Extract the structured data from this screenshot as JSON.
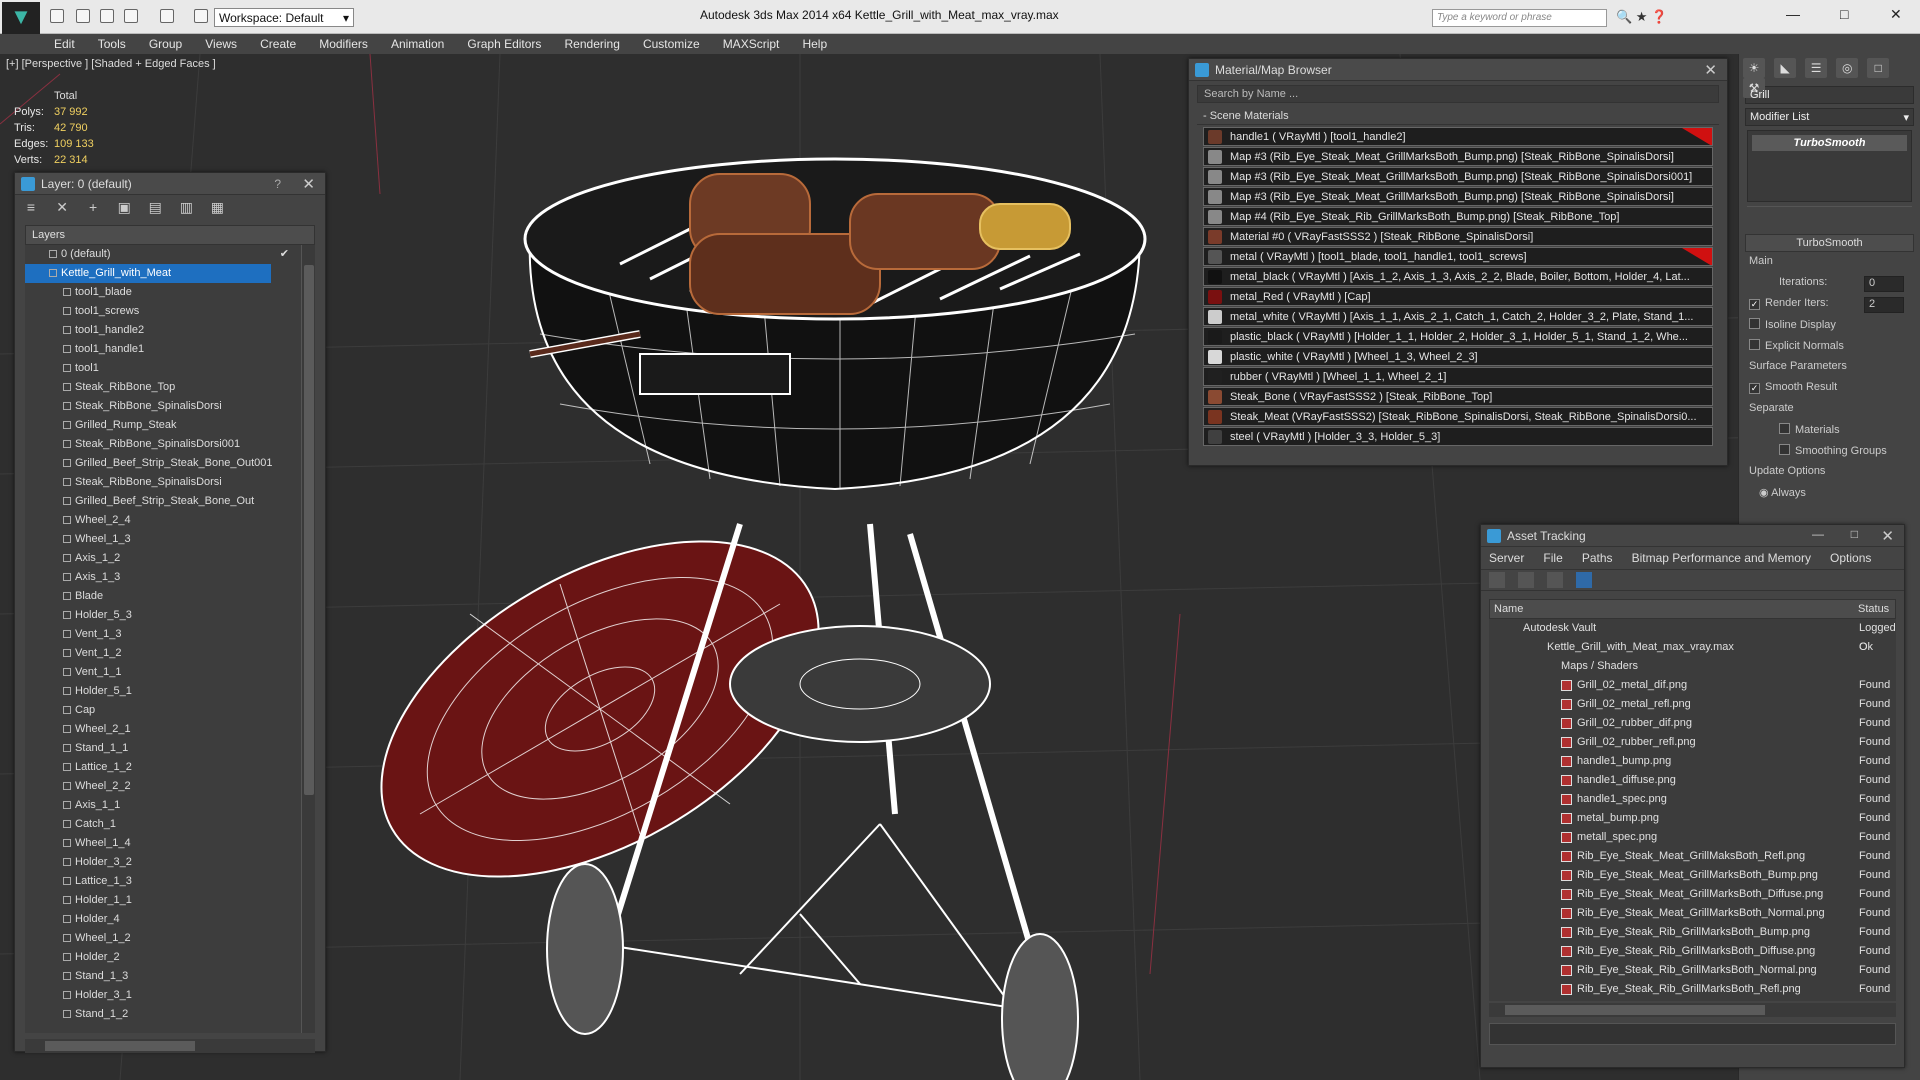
{
  "app": {
    "title": "Autodesk 3ds Max  2014 x64      Kettle_Grill_with_Meat_max_vray.max",
    "workspace": "Workspace: Default",
    "search_placeholder": "Type a keyword or phrase"
  },
  "menu": [
    "Edit",
    "Tools",
    "Group",
    "Views",
    "Create",
    "Modifiers",
    "Animation",
    "Graph Editors",
    "Rendering",
    "Customize",
    "MAXScript",
    "Help"
  ],
  "viewport": {
    "label": "[+] [Perspective ] [Shaded + Edged Faces ]",
    "stats": {
      "header": "Total",
      "rows": [
        {
          "k": "Polys:",
          "v": "37 992"
        },
        {
          "k": "Tris:",
          "v": "42 790"
        },
        {
          "k": "Edges:",
          "v": "109 133"
        },
        {
          "k": "Verts:",
          "v": "22 314"
        }
      ]
    }
  },
  "layer_panel": {
    "title": "Layer: 0 (default)",
    "help": "?",
    "column": "Layers",
    "root": "0 (default)",
    "group": "Kettle_Grill_with_Meat",
    "items": [
      "tool1_blade",
      "tool1_screws",
      "tool1_handle2",
      "tool1_handle1",
      "tool1",
      "Steak_RibBone_Top",
      "Steak_RibBone_SpinalisDorsi",
      "Grilled_Rump_Steak",
      "Steak_RibBone_SpinalisDorsi001",
      "Grilled_Beef_Strip_Steak_Bone_Out001",
      "Steak_RibBone_SpinalisDorsi",
      "Grilled_Beef_Strip_Steak_Bone_Out",
      "Wheel_2_4",
      "Wheel_1_3",
      "Axis_1_2",
      "Axis_1_3",
      "Blade",
      "Holder_5_3",
      "Vent_1_3",
      "Vent_1_2",
      "Vent_1_1",
      "Holder_5_1",
      "Cap",
      "Wheel_2_1",
      "Stand_1_1",
      "Lattice_1_2",
      "Wheel_2_2",
      "Axis_1_1",
      "Catch_1",
      "Wheel_1_4",
      "Holder_3_2",
      "Lattice_1_3",
      "Holder_1_1",
      "Holder_4",
      "Wheel_1_2",
      "Holder_2",
      "Stand_1_3",
      "Holder_3_1",
      "Stand_1_2"
    ]
  },
  "material_browser": {
    "title": "Material/Map Browser",
    "search": "Search by Name ...",
    "section": "- Scene Materials",
    "rows": [
      {
        "text": "handle1  ( VRayMtl )  [tool1_handle2]",
        "color": "#6b3a2a",
        "red": true
      },
      {
        "text": "Map #3 (Rib_Eye_Steak_Meat_GrillMarksBoth_Bump.png) [Steak_RibBone_SpinalisDorsi]",
        "color": "#888888",
        "red": false
      },
      {
        "text": "Map #3 (Rib_Eye_Steak_Meat_GrillMarksBoth_Bump.png) [Steak_RibBone_SpinalisDorsi001]",
        "color": "#888888",
        "red": false
      },
      {
        "text": "Map #3 (Rib_Eye_Steak_Meat_GrillMarksBoth_Bump.png) [Steak_RibBone_SpinalisDorsi]",
        "color": "#888888",
        "red": false
      },
      {
        "text": "Map #4 (Rib_Eye_Steak_Rib_GrillMarksBoth_Bump.png) [Steak_RibBone_Top]",
        "color": "#888888",
        "red": false
      },
      {
        "text": "Material #0  ( VRayFastSSS2 )  [Steak_RibBone_SpinalisDorsi]",
        "color": "#7a3b2a",
        "red": false
      },
      {
        "text": "metal  ( VRayMtl )  [tool1_blade, tool1_handle1, tool1_screws]",
        "color": "#555555",
        "red": true
      },
      {
        "text": "metal_black  ( VRayMtl )  [Axis_1_2, Axis_1_3, Axis_2_2, Blade, Boiler, Bottom, Holder_4, Lat...",
        "color": "#111111",
        "red": false
      },
      {
        "text": "metal_Red  ( VRayMtl )  [Cap]",
        "color": "#7a1010",
        "red": false
      },
      {
        "text": "metal_white  ( VRayMtl )  [Axis_1_1, Axis_2_1, Catch_1, Catch_2, Holder_3_2, Plate, Stand_1...",
        "color": "#cccccc",
        "red": false
      },
      {
        "text": "plastic_black  ( VRayMtl )  [Holder_1_1, Holder_2, Holder_3_1, Holder_5_1, Stand_1_2, Whe...",
        "color": "#1a1a1a",
        "red": false
      },
      {
        "text": "plastic_white  ( VRayMtl )  [Wheel_1_3, Wheel_2_3]",
        "color": "#d8d8d8",
        "red": false
      },
      {
        "text": "rubber  ( VRayMtl )  [Wheel_1_1, Wheel_2_1]",
        "color": "#202020",
        "red": false
      },
      {
        "text": "Steak_Bone  ( VRayFastSSS2 )  [Steak_RibBone_Top]",
        "color": "#8a4a32",
        "red": false
      },
      {
        "text": "Steak_Meat  (VRayFastSSS2)  [Steak_RibBone_SpinalisDorsi, Steak_RibBone_SpinalisDorsi0...",
        "color": "#7a3420",
        "red": false
      },
      {
        "text": "steel  ( VRayMtl )  [Holder_3_3, Holder_5_3]",
        "color": "#404040",
        "red": false
      }
    ]
  },
  "command_panel": {
    "object_name": "Grill",
    "modifier_list": "Modifier List",
    "stack_item": "TurboSmooth",
    "rollout": "TurboSmooth",
    "main": "Main",
    "iterations_label": "Iterations:",
    "iterations": "0",
    "render_iters_label": "Render Iters:",
    "render_iters": "2",
    "isoline": "Isoline Display",
    "explicit": "Explicit Normals",
    "surface": "Surface Parameters",
    "smooth": "Smooth Result",
    "separate": "Separate",
    "materials": "Materials",
    "smoothing": "Smoothing Groups",
    "update": "Update Options",
    "always": "Always"
  },
  "asset_tracking": {
    "title": "Asset Tracking",
    "menu": [
      "Server",
      "File",
      "Paths",
      "Bitmap Performance and Memory",
      "Options"
    ],
    "col_name": "Name",
    "col_status": "Status",
    "vault": "Autodesk Vault",
    "vault_status": "Logged O",
    "file": "Kettle_Grill_with_Meat_max_vray.max",
    "file_status": "Ok",
    "folder": "Maps / Shaders",
    "maps": [
      "Grill_02_metal_dif.png",
      "Grill_02_metal_refl.png",
      "Grill_02_rubber_dif.png",
      "Grill_02_rubber_refl.png",
      "handle1_bump.png",
      "handle1_diffuse.png",
      "handle1_spec.png",
      "metal_bump.png",
      "metall_spec.png",
      "Rib_Eye_Steak_Meat_GrillMaksBoth_Refl.png",
      "Rib_Eye_Steak_Meat_GrillMarksBoth_Bump.png",
      "Rib_Eye_Steak_Meat_GrillMarksBoth_Diffuse.png",
      "Rib_Eye_Steak_Meat_GrillMarksBoth_Normal.png",
      "Rib_Eye_Steak_Rib_GrillMarksBoth_Bump.png",
      "Rib_Eye_Steak_Rib_GrillMarksBoth_Diffuse.png",
      "Rib_Eye_Steak_Rib_GrillMarksBoth_Normal.png",
      "Rib_Eye_Steak_Rib_GrillMarksBoth_Refl.png"
    ],
    "found": "Found"
  }
}
